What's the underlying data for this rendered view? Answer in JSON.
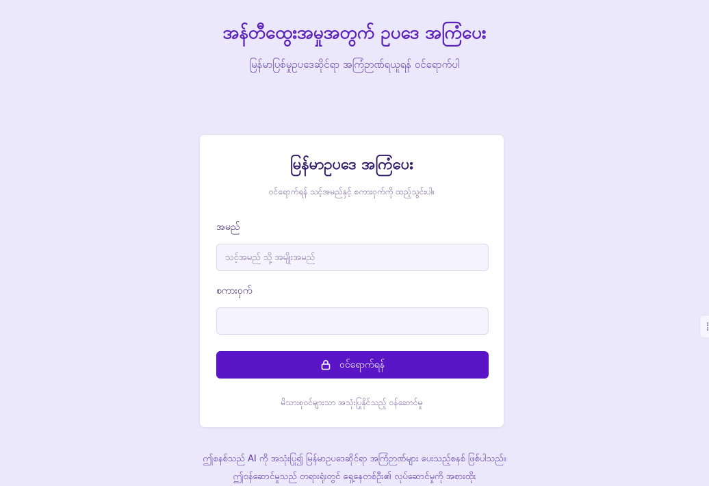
{
  "header": {
    "title": "အန်တီထွေးအမှုအတွက် ဥပဒေ အကြံပေး",
    "subtitle": "မြန်မာပြစ်မှုဥပဒေဆိုင်ရာ အကြံဉာဏ်ရယူရန် ဝင်ရောက်ပါ"
  },
  "login_card": {
    "title": "မြန်မာဥပဒေ အကြံပေး",
    "subtitle": "ဝင်ရောက်ရန် သင့်အမည်နှင့် စကားဝှက်ကို ထည့်သွင်းပါ။",
    "name_label": "အမည်",
    "name_placeholder": "သင့်အမည် သို့ အမျိုးအမည်",
    "name_value": "",
    "password_label": "စကားဝှက်",
    "password_placeholder": "",
    "password_value": "",
    "login_button_label": "ဝင်ရောက်ရန်",
    "login_button_icon": "lock-icon",
    "footer_note": "မိသားစုဝင်များသာ အသုံးပြုနိုင်သည့် ဝန်ဆောင်မှု"
  },
  "disclaimer": "ဤစနစ်သည် AI ကို အသုံးပြု၍ မြန်မာဥပဒေဆိုင်ရာ အကြံဉာဏ်များ ပေးသည့်စနစ် ဖြစ်ပါသည်။ ဤဝန်ဆောင်မှုသည် တရားရုံးတွင် ရှေ့နေတစ်ဦး၏ လုပ်ဆောင်မှုကို အစားထိုး",
  "colors": {
    "background": "#ece8fc",
    "accent": "#5a16c6",
    "title": "#5a22b8",
    "card_title": "#2d1766"
  }
}
